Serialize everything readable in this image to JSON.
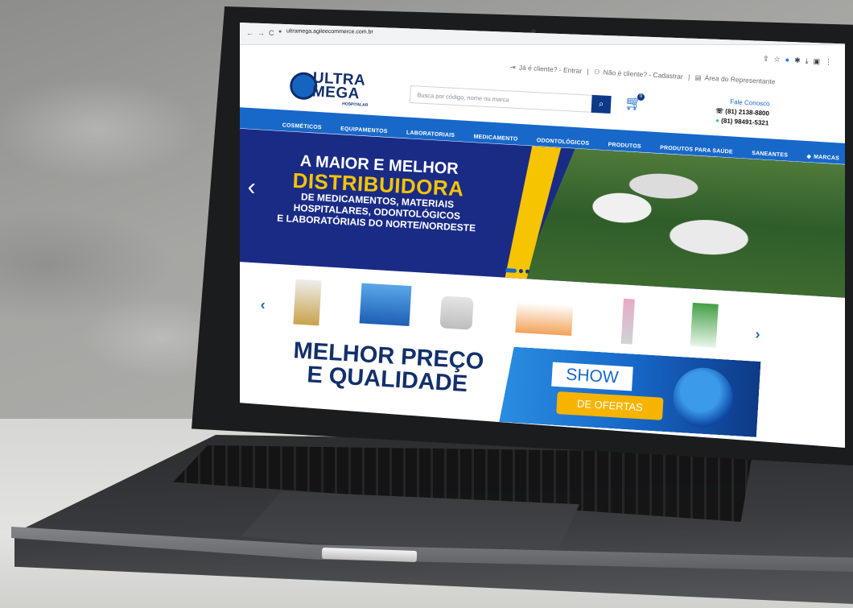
{
  "browser": {
    "url": "ultramega.agileecommerce.com.br",
    "nav_back": "←",
    "nav_forward": "→",
    "nav_reload": "C"
  },
  "header": {
    "login_link": "Já é cliente? - Entrar",
    "register_link": "Não é cliente? - Cadastrar",
    "rep_link": "Área do Representante",
    "separator": "|",
    "search_placeholder": "Busca por código, nome ou marca",
    "cart_count": "0",
    "contact_title": "Fale Conosco",
    "phone_1": "(81) 2138-8800",
    "phone_2": "(81) 98491-5321"
  },
  "logo": {
    "line1": "ULTRA",
    "line2": "MEGA",
    "sub": "HOSPITALAR"
  },
  "categories": [
    "COSMÉTICOS",
    "EQUIPAMENTOS",
    "LABORATORIAIS",
    "MEDICAMENTO",
    "ODONTOLÓGICOS",
    "PRODUTOS",
    "PRODUTOS PARA SAÚDE",
    "SANEANTES",
    "MARCAS"
  ],
  "banner": {
    "line1": "A MAIOR E MELHOR",
    "line2": "DISTRIBUIDORA",
    "line3": "DE MEDICAMENTOS, MATERIAIS",
    "line4": "HOSPITALARES, ODONTOLÓGICOS",
    "line5": "E LABORATÓRIAIS DO NORTE/NORDESTE"
  },
  "promo": {
    "line1": "MELHOR PREÇO",
    "line2": "E QUALIDADE",
    "show": "SHOW",
    "ofertas": "DE OFERTAS"
  },
  "colors": {
    "brand_blue": "#1768c9",
    "navy": "#12306b",
    "yellow": "#f6c400"
  }
}
